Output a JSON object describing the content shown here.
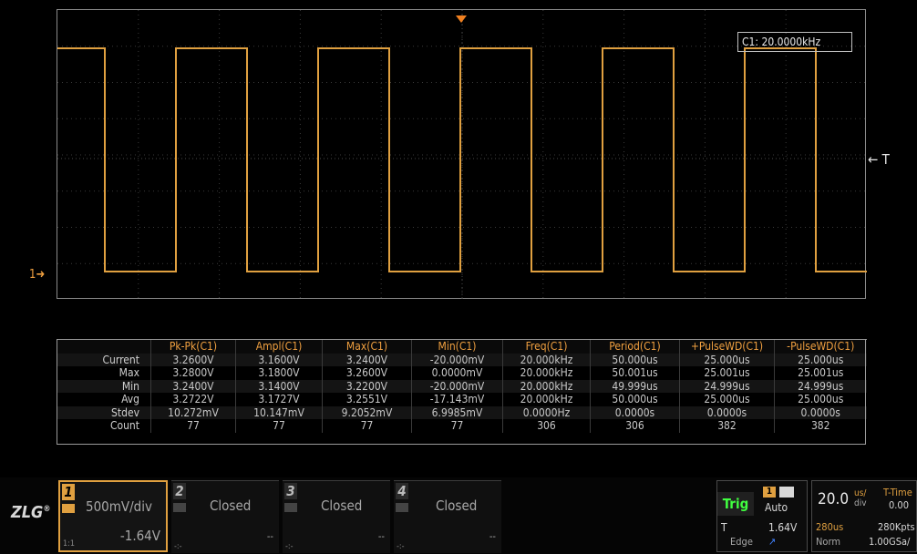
{
  "waveform": {
    "readout_label": "C1: 20.0000kHz",
    "trigger_marker_label": "T",
    "channel_marker_label": "1",
    "trace_color": "#e0a040"
  },
  "measurements": {
    "headers": [
      "",
      "Pk-Pk(C1)",
      "Ampl(C1)",
      "Max(C1)",
      "Min(C1)",
      "Freq(C1)",
      "Period(C1)",
      "+PulseWD(C1)",
      "-PulseWD(C1)"
    ],
    "rows": [
      {
        "label": "Current",
        "values": [
          "3.2600V",
          "3.1600V",
          "3.2400V",
          "-20.000mV",
          "20.000kHz",
          "50.000us",
          "25.000us",
          "25.000us"
        ]
      },
      {
        "label": "Max",
        "values": [
          "3.2800V",
          "3.1800V",
          "3.2600V",
          "0.0000mV",
          "20.000kHz",
          "50.001us",
          "25.001us",
          "25.001us"
        ]
      },
      {
        "label": "Min",
        "values": [
          "3.2400V",
          "3.1400V",
          "3.2200V",
          "-20.000mV",
          "20.000kHz",
          "49.999us",
          "24.999us",
          "24.999us"
        ]
      },
      {
        "label": "Avg",
        "values": [
          "3.2722V",
          "3.1727V",
          "3.2551V",
          "-17.143mV",
          "20.000kHz",
          "50.000us",
          "25.000us",
          "25.000us"
        ]
      },
      {
        "label": "Stdev",
        "values": [
          "10.272mV",
          "10.147mV",
          "9.2052mV",
          "6.9985mV",
          "0.0000Hz",
          "0.0000s",
          "0.0000s",
          "0.0000s"
        ]
      },
      {
        "label": "Count",
        "values": [
          "77",
          "77",
          "77",
          "77",
          "306",
          "306",
          "382",
          "382"
        ]
      }
    ]
  },
  "channels": [
    {
      "num": "1",
      "scale": "500mV/div",
      "offset": "-1.64V",
      "footer": "1:1"
    },
    {
      "num": "2",
      "scale": "Closed",
      "offset": "--",
      "footer": "-:-"
    },
    {
      "num": "3",
      "scale": "Closed",
      "offset": "--",
      "footer": "-:-"
    },
    {
      "num": "4",
      "scale": "Closed",
      "offset": "--",
      "footer": "-:-"
    }
  ],
  "trigger": {
    "label": "Trig",
    "channel": "1",
    "mode": "Auto",
    "type_prefix": "T",
    "level": "1.64V",
    "type": "Edge"
  },
  "timebase": {
    "scale_value": "20.0",
    "scale_unit_top": "us/",
    "scale_unit_bottom": "div",
    "delay_label": "T-Time",
    "delay_value": "0.00",
    "position": "280us",
    "points": "280Kpts",
    "acq_mode": "Norm",
    "sample_rate": "1.00GSa/"
  },
  "logo": {
    "text": "ZLG"
  }
}
